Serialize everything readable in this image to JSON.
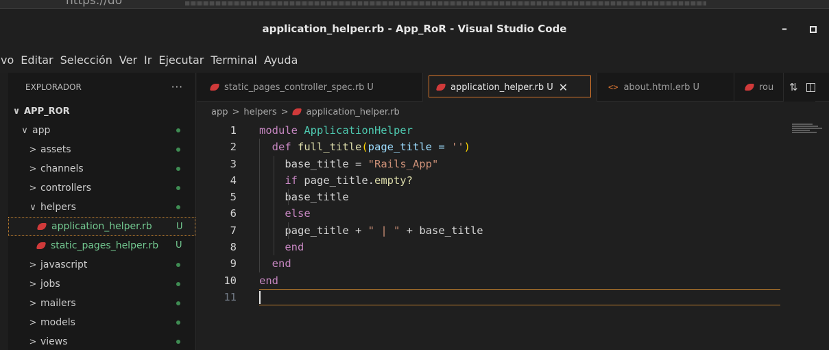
{
  "browser": {
    "url": "https://do"
  },
  "window": {
    "title": "application_helper.rb - App_RoR - Visual Studio Code"
  },
  "menu": [
    "vo",
    "Editar",
    "Selección",
    "Ver",
    "Ir",
    "Ejecutar",
    "Terminal",
    "Ayuda"
  ],
  "sidebar": {
    "header": "EXPLORADOR",
    "more": "···",
    "root": "APP_ROR",
    "folder_app": "app",
    "items": [
      {
        "label": "assets",
        "chev": ">"
      },
      {
        "label": "channels",
        "chev": ">"
      },
      {
        "label": "controllers",
        "chev": ">"
      },
      {
        "label": "helpers",
        "chev": "∨"
      },
      {
        "label": "application_helper.rb",
        "badge": "U"
      },
      {
        "label": "static_pages_helper.rb",
        "badge": "U"
      },
      {
        "label": "javascript",
        "chev": ">"
      },
      {
        "label": "jobs",
        "chev": ">"
      },
      {
        "label": "mailers",
        "chev": ">"
      },
      {
        "label": "models",
        "chev": ">"
      },
      {
        "label": "views",
        "chev": ">"
      }
    ],
    "root_chev": "∨",
    "app_chev": "∨"
  },
  "tabs": [
    {
      "label": "static_pages_controller_spec.rb",
      "badge": "U"
    },
    {
      "label": "application_helper.rb",
      "badge": "U",
      "close": "✕"
    },
    {
      "label": "about.html.erb",
      "badge": "U",
      "icon": "<>"
    },
    {
      "label": "rou"
    }
  ],
  "breadcrumb": {
    "part1": "app",
    "part2": "helpers",
    "part3": "application_helper.rb",
    "sep": ">"
  },
  "editor": {
    "line_numbers": [
      "1",
      "2",
      "3",
      "4",
      "5",
      "6",
      "7",
      "8",
      "9",
      "10",
      "11"
    ],
    "lines": {
      "l1_kw": "module ",
      "l1_cls": "ApplicationHelper",
      "l2_kw": "def ",
      "l2_fn": "full_title",
      "l2_p1": "(",
      "l2_var": "page_title = ",
      "l2_str": "''",
      "l2_p2": ")",
      "l3_a": "base_title = ",
      "l3_str": "\"Rails_App\"",
      "l4_kw": "if ",
      "l4_a": "page_title.",
      "l4_fn": "empty?",
      "l5": "base_title",
      "l6_kw": "else",
      "l7_a": "page_title + ",
      "l7_str": "\" | \"",
      "l7_b": " + base_title",
      "l8_kw": "end",
      "l9_kw": "end",
      "l10_kw": "end"
    }
  },
  "colors": {
    "accent": "#d9772b",
    "ruby": "#d03a3a",
    "untracked": "#73c991"
  },
  "icons": [
    "ruby-file-icon",
    "html-file-icon",
    "source-control-icon",
    "split-editor-icon",
    "chevron-icon",
    "close-icon"
  ]
}
